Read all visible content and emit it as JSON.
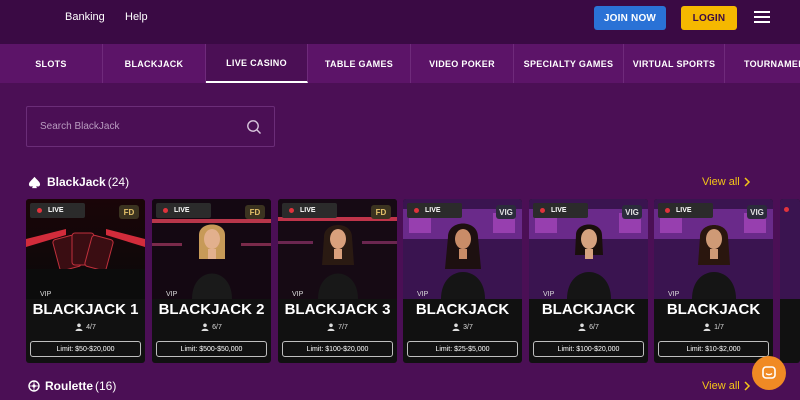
{
  "topbar": {
    "links": [
      "Banking",
      "Help"
    ],
    "join_label": "JOIN NOW",
    "login_label": "LOGIN",
    "colors": {
      "join": "#2a72d6",
      "login": "#f5b800"
    }
  },
  "categories": [
    {
      "label": "SLOTS",
      "active": false
    },
    {
      "label": "BLACKJACK",
      "active": false
    },
    {
      "label": "LIVE CASINO",
      "active": true
    },
    {
      "label": "TABLE GAMES",
      "active": false
    },
    {
      "label": "VIDEO POKER",
      "active": false
    },
    {
      "label": "SPECIALTY GAMES",
      "active": false
    },
    {
      "label": "VIRTUAL SPORTS",
      "active": false
    },
    {
      "label": "TOURNAMEN",
      "active": false
    }
  ],
  "search": {
    "placeholder": "Search BlackJack",
    "icon": "search-icon"
  },
  "blackjack_section": {
    "title": "BlackJack",
    "count": "(24)",
    "view_all": "View all",
    "icon": "spade-icon"
  },
  "games": [
    {
      "live": "LIVE",
      "provider": "FD",
      "vip": "VIP",
      "name": "BLACKJACK 1",
      "seats": "4/7",
      "limit": "Limit: $50-$20,000"
    },
    {
      "live": "LIVE",
      "provider": "FD",
      "vip": "VIP",
      "name": "BLACKJACK 2",
      "seats": "6/7",
      "limit": "Limit: $500-$50,000"
    },
    {
      "live": "LIVE",
      "provider": "FD",
      "vip": "VIP",
      "name": "BLACKJACK 3",
      "seats": "7/7",
      "limit": "Limit: $100-$20,000"
    },
    {
      "live": "LIVE",
      "provider": "VIG",
      "vip": "VIP",
      "name": "BLACKJACK",
      "seats": "3/7",
      "limit": "Limit: $25-$5,000"
    },
    {
      "live": "LIVE",
      "provider": "VIG",
      "vip": "VIP",
      "name": "BLACKJACK",
      "seats": "6/7",
      "limit": "Limit: $100-$20,000"
    },
    {
      "live": "LIVE",
      "provider": "VIG",
      "vip": "VIP",
      "name": "BLACKJACK",
      "seats": "1/7",
      "limit": "Limit: $10-$2,000"
    }
  ],
  "roulette_section": {
    "title": "Roulette",
    "count": "(16)",
    "view_all": "View all",
    "icon": "roulette-icon"
  },
  "chat": {
    "icon": "chat-icon",
    "color": "#f08a24"
  }
}
